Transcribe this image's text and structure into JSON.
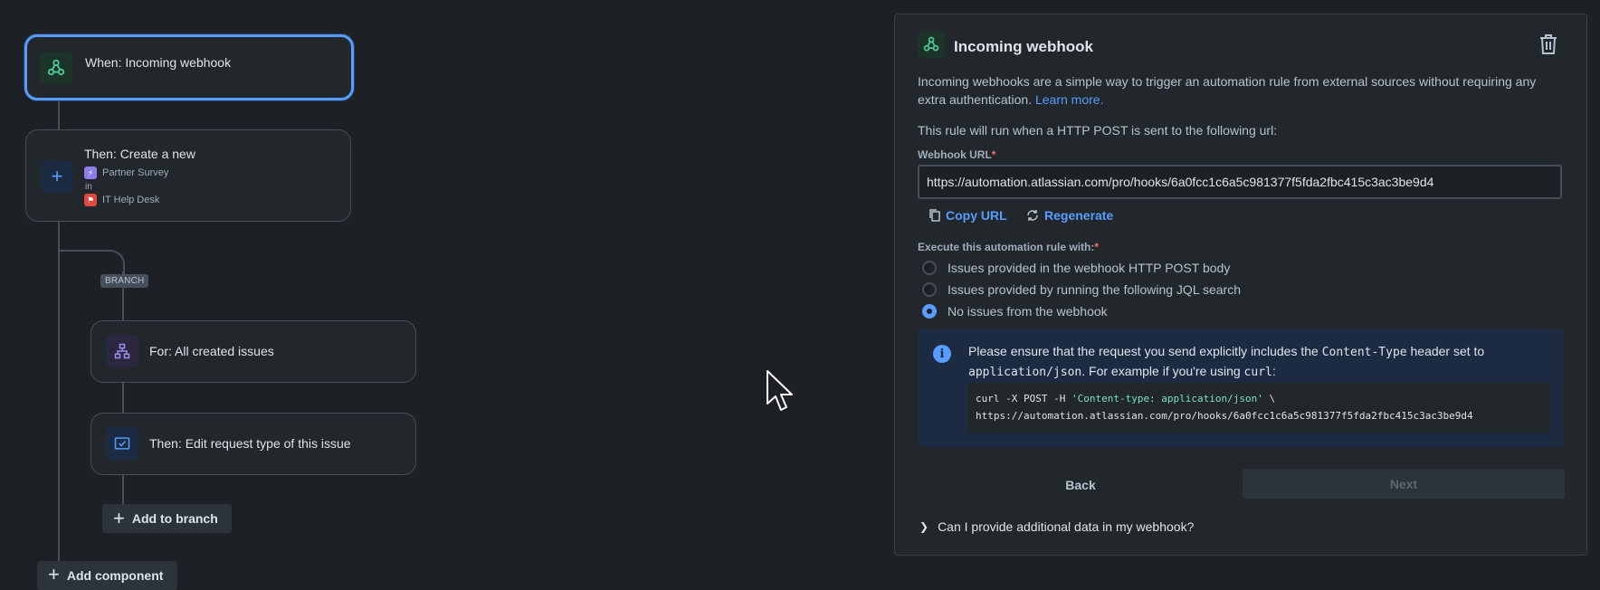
{
  "flow": {
    "trigger": {
      "title": "When: Incoming webhook"
    },
    "action1": {
      "title": "Then: Create a new",
      "request_type": "Partner Survey",
      "in_label": "in",
      "project": "IT Help Desk"
    },
    "branch_badge": "BRANCH",
    "branch_for": {
      "title": "For: All created issues"
    },
    "branch_then": {
      "title": "Then: Edit request type of this issue"
    },
    "add_to_branch": "Add to branch",
    "add_component": "Add component"
  },
  "panel": {
    "title": "Incoming webhook",
    "description": "Incoming webhooks are a simple way to trigger an automation rule from external sources without requiring any extra authentication.",
    "learn_more": "Learn more.",
    "run_text": "This rule will run when a HTTP POST is sent to the following url:",
    "webhook_label": "Webhook URL",
    "required_mark": "*",
    "webhook_url": "https://automation.atlassian.com/pro/hooks/6a0fcc1c6a5c981377f5fda2fbc415c3ac3be9d4",
    "copy_url": "Copy URL",
    "regenerate": "Regenerate",
    "execute_label": "Execute this automation rule with:",
    "options": [
      {
        "label": "Issues provided in the webhook HTTP POST body",
        "checked": false
      },
      {
        "label": "Issues provided by running the following JQL search",
        "checked": false
      },
      {
        "label": "No issues from the webhook",
        "checked": true
      }
    ],
    "info": {
      "text_1": "Please ensure that the request you send explicitly includes the ",
      "code_header": "Content-Type",
      "text_2": " header set to ",
      "code_json": "application/json",
      "text_3": ". For example if you're using ",
      "code_curl": "curl",
      "text_4": ":",
      "code_line1_cmd": "curl -X POST -H ",
      "code_line1_str": "'Content-type: application/json'",
      "code_line1_end": " \\",
      "code_line2": "https://automation.atlassian.com/pro/hooks/6a0fcc1c6a5c981377f5fda2fbc415c3ac3be9d4"
    },
    "back": "Back",
    "next": "Next",
    "faq": "Can I provide additional data in my webhook?"
  },
  "colors": {
    "background": "#1d2125",
    "surface": "#22272b",
    "accent": "#579dff",
    "webhook_green": "#4bce97",
    "branch_purple": "#9f8fef"
  }
}
